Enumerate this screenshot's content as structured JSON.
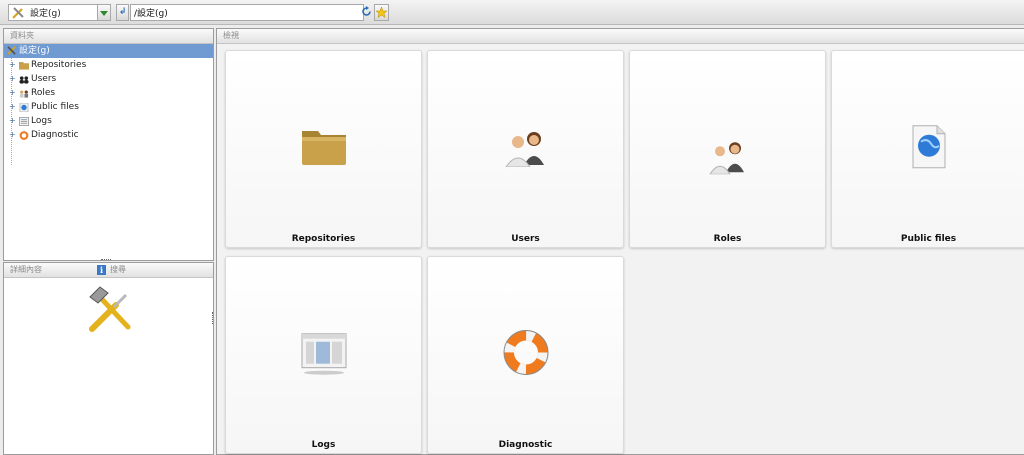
{
  "toolbar": {
    "workspace_label": "設定(g)",
    "path_value": "/設定(g)"
  },
  "folders_panel": {
    "title": "資料夾",
    "root": "設定(g)",
    "items": [
      {
        "label": "Repositories",
        "icon": "folder-icon"
      },
      {
        "label": "Users",
        "icon": "users-icon"
      },
      {
        "label": "Roles",
        "icon": "roles-icon"
      },
      {
        "label": "Public files",
        "icon": "public-files-icon"
      },
      {
        "label": "Logs",
        "icon": "logs-icon"
      },
      {
        "label": "Diagnostic",
        "icon": "lifebuoy-icon"
      }
    ]
  },
  "details_panel": {
    "title": "詳細內容",
    "search_tab": "搜尋"
  },
  "main_panel": {
    "title": "檢視",
    "tiles": [
      "Repositories",
      "Users",
      "Roles",
      "Public files",
      "Logs",
      "Diagnostic"
    ]
  },
  "colors": {
    "selection": "#6f9bd2",
    "folder": "#c9a14a",
    "lifebuoy": "#f07a1e"
  }
}
